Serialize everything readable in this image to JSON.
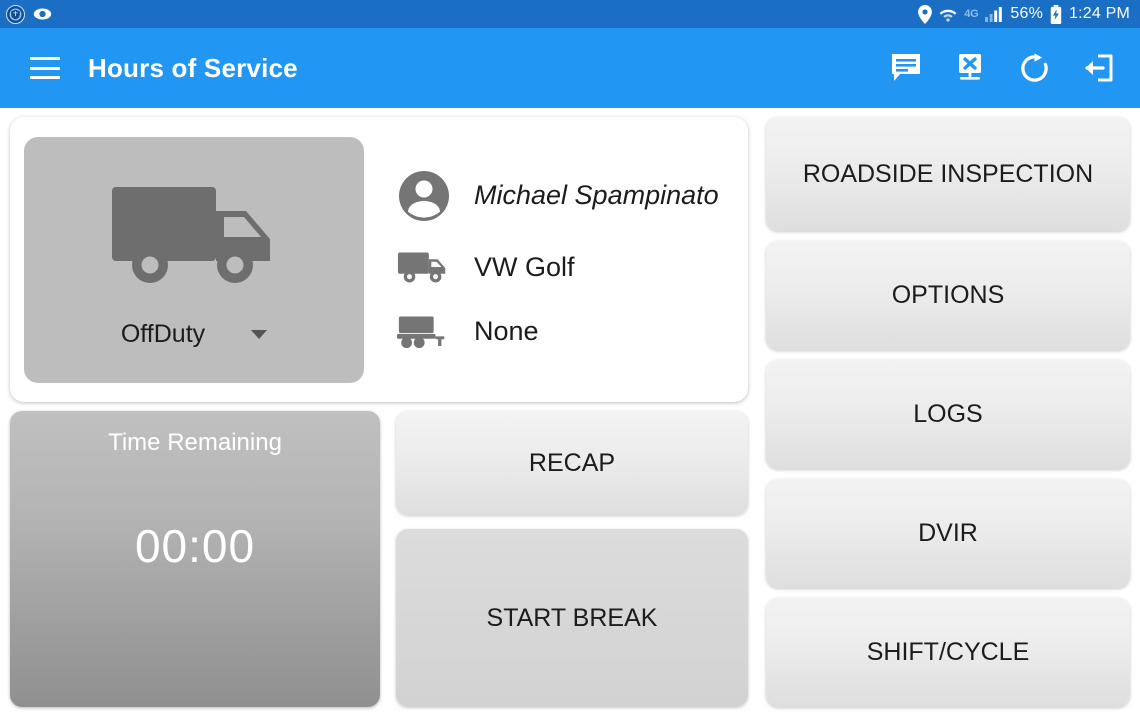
{
  "status_bar": {
    "left_icons": [
      {
        "name": "app-notification-icon",
        "label": "app-badge"
      },
      {
        "name": "eye-icon",
        "label": "visibility"
      }
    ],
    "right_icons": [
      {
        "name": "location-pin-icon",
        "label": "location"
      },
      {
        "name": "wifi-icon",
        "label": "wifi"
      },
      {
        "name": "network-4g-icon",
        "label": "4G"
      },
      {
        "name": "signal-bars-icon",
        "label": "signal"
      }
    ],
    "network_label": "4G",
    "battery_percent": "56%",
    "time": "1:24 PM",
    "background_color": "#1a6ec4",
    "text_color": "#ffffff"
  },
  "app_bar": {
    "menu_icon": "hamburger-menu-icon",
    "title": "Hours of Service",
    "background_color": "#2196f3",
    "actions": [
      {
        "name": "messages-icon",
        "label": "Messages"
      },
      {
        "name": "device-disconnected-icon",
        "label": "Device Disconnected"
      },
      {
        "name": "refresh-icon",
        "label": "Refresh"
      },
      {
        "name": "logout-icon",
        "label": "Logout"
      }
    ]
  },
  "driver_card": {
    "duty_status": {
      "icon": "truck-icon",
      "label": "OffDuty",
      "dropdown_icon": "caret-down-icon",
      "background_color": "#bdbdbd"
    },
    "rows": [
      {
        "icon": "person-avatar-icon",
        "value": "Michael Spampinato",
        "italic": true
      },
      {
        "icon": "truck-icon",
        "value": "VW Golf",
        "italic": false
      },
      {
        "icon": "trailer-icon",
        "value": "None",
        "italic": false
      }
    ]
  },
  "time_remaining": {
    "label": "Time Remaining",
    "value": "00:00"
  },
  "main_actions": [
    {
      "name": "recap-button",
      "label": "RECAP"
    },
    {
      "name": "start-break-button",
      "label": "START BREAK"
    }
  ],
  "side_actions": [
    {
      "name": "roadside-inspection-button",
      "label": "ROADSIDE INSPECTION"
    },
    {
      "name": "options-button",
      "label": "OPTIONS"
    },
    {
      "name": "logs-button",
      "label": "LOGS"
    },
    {
      "name": "dvir-button",
      "label": "DVIR"
    },
    {
      "name": "shift-cycle-button",
      "label": "SHIFT/CYCLE"
    }
  ]
}
